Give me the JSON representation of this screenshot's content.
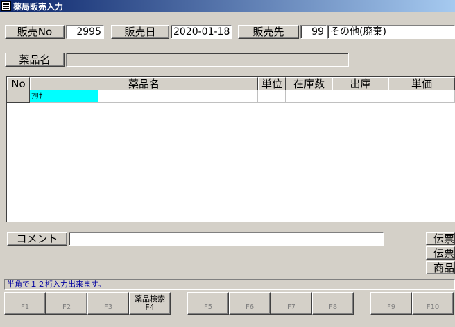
{
  "window": {
    "title": "薬局販売入力",
    "icon": "app-form-icon"
  },
  "header": {
    "sale_no_label": "販売No",
    "sale_no_value": "2995",
    "sale_date_label": "販売日",
    "sale_date_value": "2020-01-18",
    "customer_label": "販売先",
    "customer_code": "99",
    "customer_name": "その他(廃棄)",
    "drug_name_label": "薬品名",
    "drug_name_value": ""
  },
  "grid": {
    "columns": [
      "No",
      "薬品名",
      "単位",
      "在庫数",
      "出庫",
      "単価"
    ],
    "rows": [
      {
        "no": "",
        "name": "ｱﾘﾅ",
        "unit": "",
        "stock": "",
        "out": "",
        "price": ""
      }
    ]
  },
  "comment": {
    "label": "コメント",
    "value": ""
  },
  "side_buttons": [
    "伝票",
    "伝票",
    "商品"
  ],
  "status": {
    "message": "半角で１２桁入力出来ます。"
  },
  "fkeys": [
    {
      "caption": "",
      "key": "F1",
      "enabled": false
    },
    {
      "caption": "",
      "key": "F2",
      "enabled": false
    },
    {
      "caption": "",
      "key": "F3",
      "enabled": false
    },
    {
      "caption": "薬品検索",
      "key": "F4",
      "enabled": true
    },
    {
      "caption": "",
      "key": "F5",
      "enabled": false
    },
    {
      "caption": "",
      "key": "F6",
      "enabled": false
    },
    {
      "caption": "",
      "key": "F7",
      "enabled": false
    },
    {
      "caption": "",
      "key": "F8",
      "enabled": false
    },
    {
      "caption": "",
      "key": "F9",
      "enabled": false
    },
    {
      "caption": "",
      "key": "F10",
      "enabled": false
    }
  ],
  "colors": {
    "titlebar_start": "#0a246a",
    "active_cell": "#00ffff",
    "status_text": "#0000a0"
  }
}
